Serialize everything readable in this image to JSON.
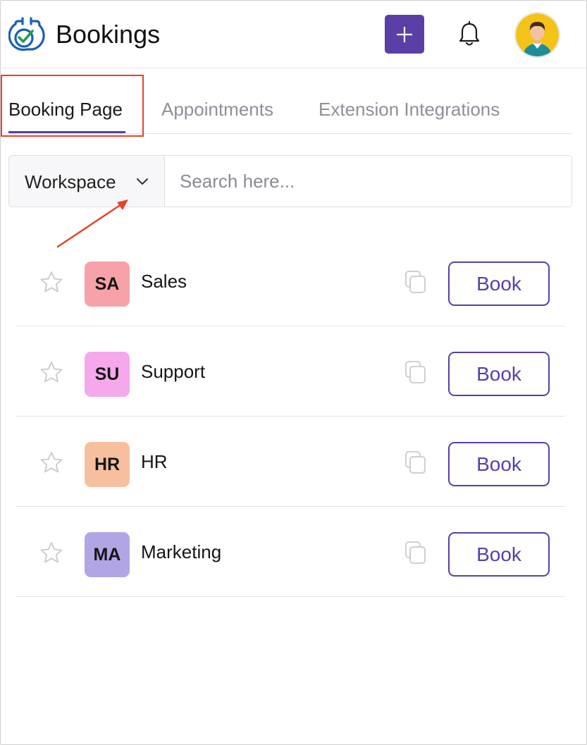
{
  "header": {
    "title": "Bookings",
    "logo_icon": "calendar-check-logo",
    "add_icon": "plus-icon",
    "notification_icon": "bell-icon",
    "avatar_icon": "user-avatar"
  },
  "tabs": [
    {
      "label": "Booking Page",
      "active": true
    },
    {
      "label": "Appointments",
      "active": false
    },
    {
      "label": "Extension Integrations",
      "active": false
    }
  ],
  "filter": {
    "workspace_label": "Workspace",
    "search_placeholder": "Search here..."
  },
  "workspaces": [
    {
      "initials": "SA",
      "name": "Sales",
      "color": "#f7a1a8",
      "book_label": "Book"
    },
    {
      "initials": "SU",
      "name": "Support",
      "color": "#f5a8ec",
      "book_label": "Book"
    },
    {
      "initials": "HR",
      "name": "HR",
      "color": "#f6c09e",
      "book_label": "Book"
    },
    {
      "initials": "MA",
      "name": "Marketing",
      "color": "#b2a5e6",
      "book_label": "Book"
    }
  ],
  "colors": {
    "accent": "#5a3fa6",
    "annotation": "#e4432a"
  }
}
